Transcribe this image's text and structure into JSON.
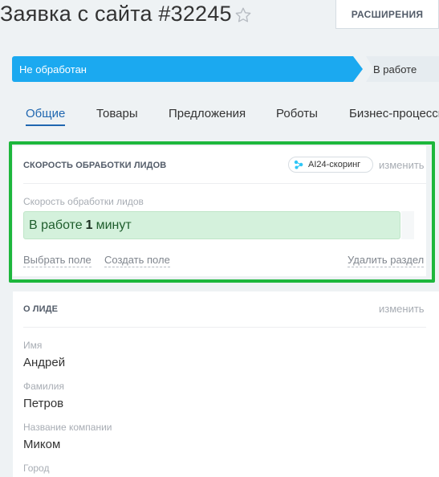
{
  "header": {
    "title": "Заявка с сайта #32245",
    "star_icon": "star-icon",
    "extensions_label": "РАСШИРЕНИЯ"
  },
  "stages": {
    "current": "Не обработан",
    "next": "В работе",
    "current_color": "#1ba9f0"
  },
  "tabs": [
    {
      "label": "Общие",
      "active": true
    },
    {
      "label": "Товары"
    },
    {
      "label": "Предложения"
    },
    {
      "label": "Роботы"
    },
    {
      "label": "Бизнес-процессы"
    }
  ],
  "speed_section": {
    "title": "СКОРОСТЬ ОБРАБОТКИ ЛИДОВ",
    "badge_label": "AI24-скоринг",
    "badge_icon": "ai-network-icon",
    "edit_label": "изменить",
    "field_label": "Скорость обработки лидов",
    "value_prefix": "В работе",
    "value_number": "1",
    "value_suffix": "минут",
    "select_field": "Выбрать поле",
    "create_field": "Создать поле",
    "delete_section": "Удалить раздел",
    "highlight_color": "#1db73c"
  },
  "lead_section": {
    "title": "О ЛИДЕ",
    "edit_label": "изменить",
    "fields": [
      {
        "label": "Имя",
        "value": "Андрей"
      },
      {
        "label": "Фамилия",
        "value": "Петров"
      },
      {
        "label": "Название компании",
        "value": "Миком"
      },
      {
        "label": "Город",
        "value": ""
      }
    ]
  }
}
